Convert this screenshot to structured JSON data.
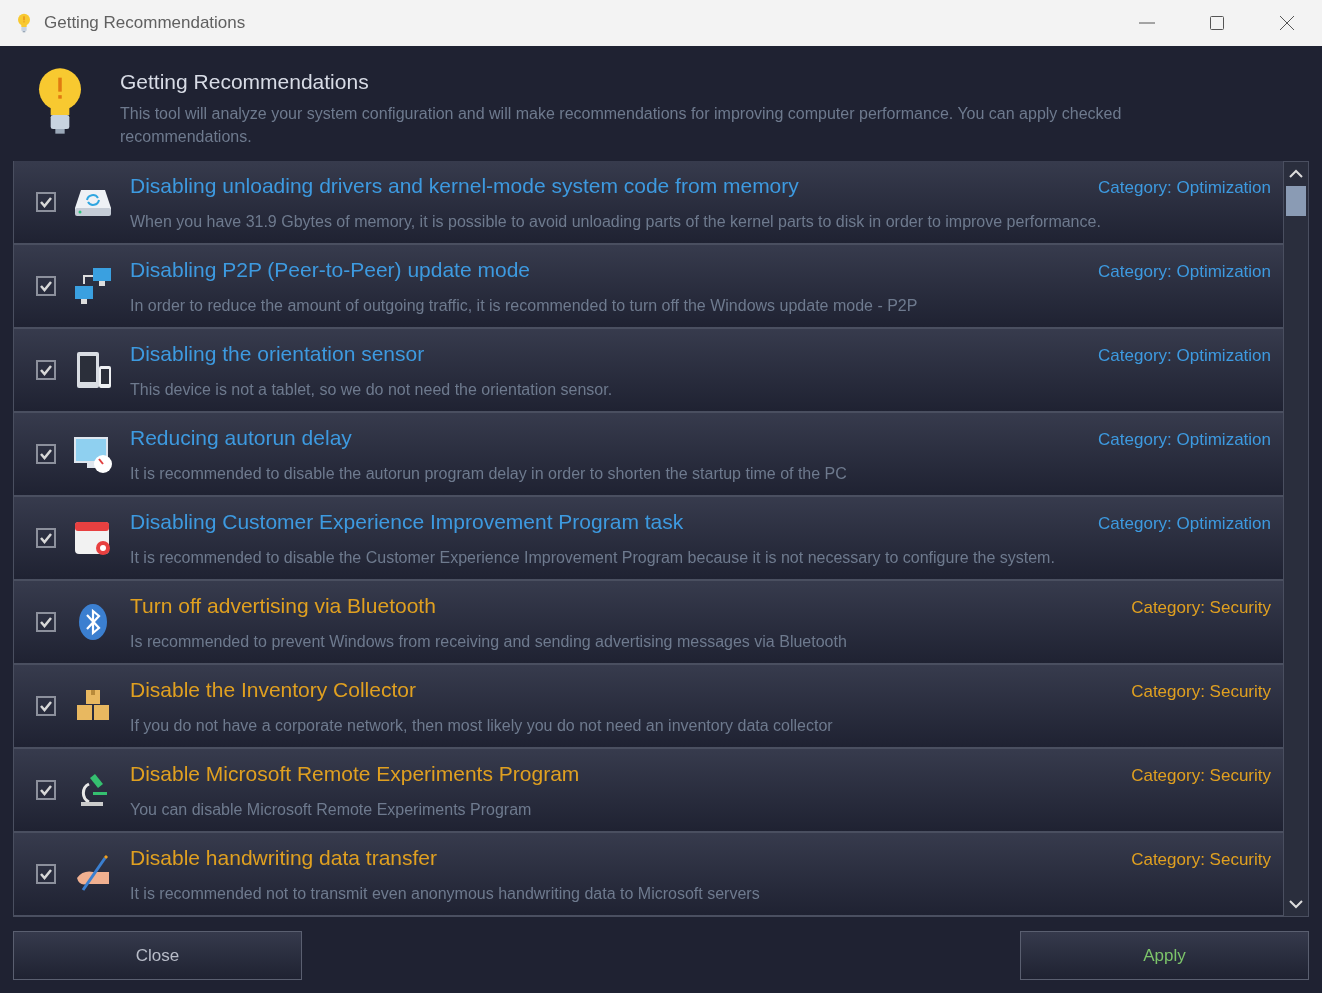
{
  "window": {
    "title": "Getting Recommendations"
  },
  "header": {
    "title": "Getting Recommendations",
    "description": "This tool will analyze your system configuration and will make recommendations for improving computer performance. You can apply checked recommendations."
  },
  "items": [
    {
      "title": "Disabling unloading drivers and kernel-mode system code from memory",
      "description": "When you have 31.9 Gbytes of memory, it is possible to avoid unloading parts of the kernel parts to disk in order to improve performance.",
      "category": "Category: Optimization",
      "kind": "optimization",
      "checked": true
    },
    {
      "title": "Disabling P2P (Peer-to-Peer) update mode",
      "description": "In order to reduce the amount of outgoing traffic, it is recommended to turn off the Windows update mode - P2P",
      "category": "Category: Optimization",
      "kind": "optimization",
      "checked": true
    },
    {
      "title": "Disabling the orientation sensor",
      "description": "This device is not a tablet, so we do not need the orientation sensor.",
      "category": "Category: Optimization",
      "kind": "optimization",
      "checked": true
    },
    {
      "title": "Reducing autorun delay",
      "description": "It is recommended to disable the autorun program delay in order to shorten the startup time of the PC",
      "category": "Category: Optimization",
      "kind": "optimization",
      "checked": true
    },
    {
      "title": "Disabling Customer Experience Improvement Program task",
      "description": "It is recommended to disable the Customer Experience Improvement Program because it is not necessary to configure the system.",
      "category": "Category: Optimization",
      "kind": "optimization",
      "checked": true
    },
    {
      "title": "Turn off advertising via Bluetooth",
      "description": "Is recommended to prevent Windows from receiving and sending advertising messages via Bluetooth",
      "category": "Category: Security",
      "kind": "security",
      "checked": true
    },
    {
      "title": "Disable the Inventory Collector",
      "description": "If you do not have a corporate network, then most likely you do not need an inventory data collector",
      "category": "Category: Security",
      "kind": "security",
      "checked": true
    },
    {
      "title": "Disable Microsoft Remote Experiments Program",
      "description": "You can disable Microsoft Remote Experiments Program",
      "category": "Category: Security",
      "kind": "security",
      "checked": true
    },
    {
      "title": "Disable handwriting data transfer",
      "description": "It is recommended not to transmit even anonymous handwriting data to Microsoft servers",
      "category": "Category: Security",
      "kind": "security",
      "checked": true
    }
  ],
  "buttons": [
    {
      "label": "Close",
      "kind": "close"
    },
    {
      "label": "Apply",
      "kind": "apply"
    }
  ]
}
